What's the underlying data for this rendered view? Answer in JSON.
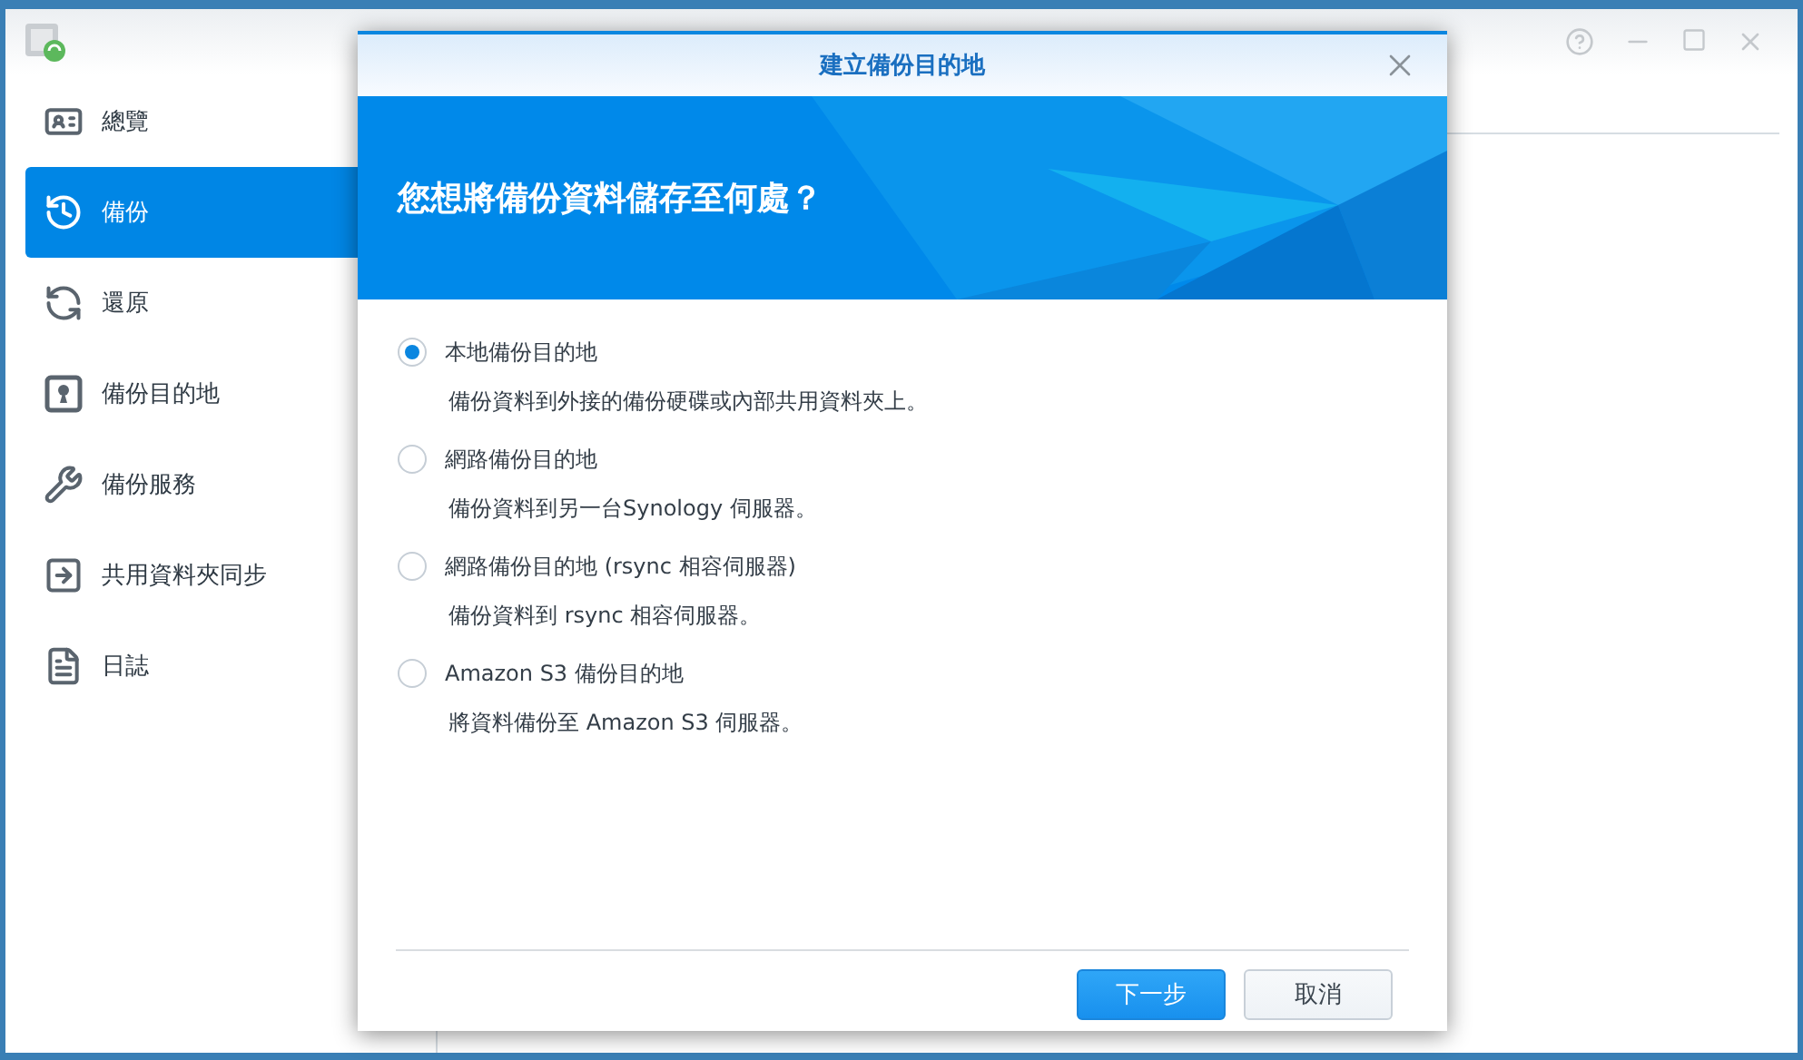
{
  "sidebar": {
    "items": [
      {
        "label": "總覽",
        "selected": false
      },
      {
        "label": "備份",
        "selected": true
      },
      {
        "label": "還原",
        "selected": false
      },
      {
        "label": "備份目的地",
        "selected": false
      },
      {
        "label": "備份服務",
        "selected": false
      },
      {
        "label": "共用資料夾同步",
        "selected": false
      },
      {
        "label": "日誌",
        "selected": false
      }
    ]
  },
  "dialog": {
    "title": "建立備份目的地",
    "heading": "您想將備份資料儲存至何處？",
    "options": [
      {
        "label": "本地備份目的地",
        "description": "備份資料到外接的備份硬碟或內部共用資料夾上。",
        "selected": true
      },
      {
        "label": "網路備份目的地",
        "description": "備份資料到另一台Synology 伺服器。",
        "selected": false
      },
      {
        "label": "網路備份目的地 (rsync 相容伺服器)",
        "description": "備份資料到 rsync 相容伺服器。",
        "selected": false
      },
      {
        "label": "Amazon S3 備份目的地",
        "description": "將資料備份至 Amazon S3 伺服器。",
        "selected": false
      }
    ],
    "buttons": [
      {
        "label": "下一步",
        "kind": "primary"
      },
      {
        "label": "取消",
        "kind": "secondary"
      }
    ]
  }
}
